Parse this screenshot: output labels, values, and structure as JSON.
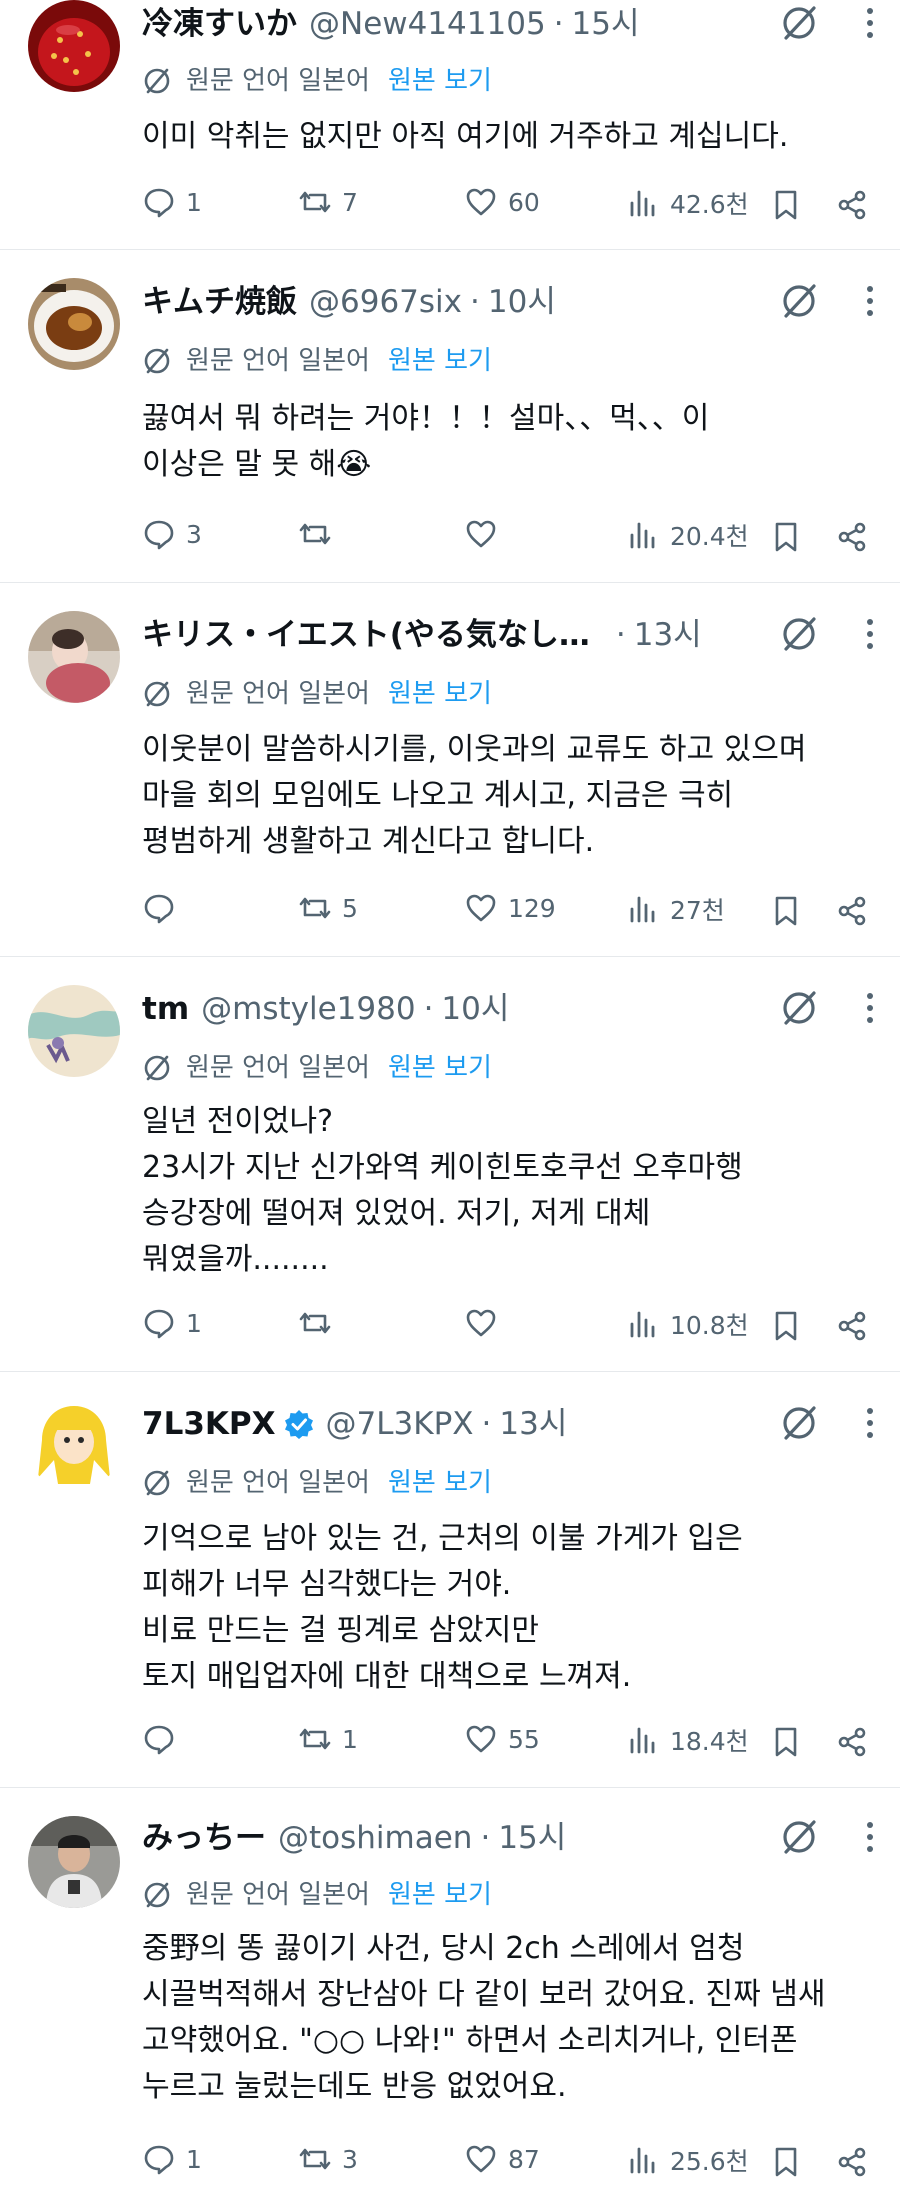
{
  "colors": {
    "accent": "#1d9bf0",
    "secondary_text": "#536471",
    "primary_text": "#0f1419",
    "divider": "#e6e9ec",
    "verified": "#1d9bf0"
  },
  "tweets": [
    {
      "name": "冷凍すいか",
      "handle": "@New4141105",
      "sep": "·",
      "time": "15시",
      "translation": {
        "lang": "원문 언어 일본어",
        "show_original": "원본 보기"
      },
      "lines": [
        "이미 악취는 없지만 아직 여기에 거주하고 계십니다."
      ],
      "replies": "1",
      "retweets": "7",
      "likes": "60",
      "views": "42.6천",
      "avatar_icon": "strawberry-avatar"
    },
    {
      "name": "キムチ焼飯",
      "handle": "@6967six",
      "sep": "·",
      "time": "10시",
      "translation": {
        "lang": "원문 언어 일본어",
        "show_original": "원본 보기"
      },
      "lines": [
        "끓여서 뭐 하려는 거야！！！설마、、먹、、이",
        "이상은 말 못 해😭"
      ],
      "replies": "3",
      "retweets": "",
      "likes": "",
      "views": "20.4천",
      "avatar_icon": "curry-plate-avatar"
    },
    {
      "name": "キリス・イエスト(やる気なし…",
      "handle": "",
      "sep": "·",
      "time": "13시",
      "translation": {
        "lang": "원문 언어 일본어",
        "show_original": "원본 보기"
      },
      "lines": [
        "이웃분이 말씀하시기를, 이웃과의 교류도 하고 있으며",
        "마을 회의 모임에도 나오고 계시고, 지금은 극히",
        "평범하게 생활하고 계신다고 합니다."
      ],
      "replies": "",
      "retweets": "5",
      "likes": "129",
      "views": "27천",
      "avatar_icon": "photo-avatar"
    },
    {
      "name": "tm",
      "handle": "@mstyle1980",
      "sep": "·",
      "time": "10시",
      "translation": {
        "lang": "원문 언어 일본어",
        "show_original": "원본 보기"
      },
      "lines": [
        "일년 전이었나?",
        "23시가 지난 신가와역 케이힌토호쿠선 오후마행",
        "승강장에 떨어져 있었어. 저기, 저게 대체",
        "뭐였을까........"
      ],
      "replies": "1",
      "retweets": "",
      "likes": "",
      "views": "10.8천",
      "avatar_icon": "illustration-avatar"
    },
    {
      "name": "7L3KPX",
      "handle": "@7L3KPX",
      "sep": "·",
      "time": "13시",
      "verified": true,
      "translation": {
        "lang": "원문 언어 일본어",
        "show_original": "원본 보기"
      },
      "lines": [
        "기억으로 남아 있는 건, 근처의 이불 가게가 입은",
        "피해가 너무 심각했다는 거야.",
        "비료 만드는 걸 핑계로 삼았지만",
        "토지 매입업자에 대한 대책으로 느껴져."
      ],
      "replies": "",
      "retweets": "1",
      "likes": "55",
      "views": "18.4천",
      "avatar_icon": "blonde-character-avatar"
    },
    {
      "name": "みっちー",
      "handle": "@toshimaen",
      "sep": "·",
      "time": "15시",
      "translation": {
        "lang": "원문 언어 일본어",
        "show_original": "원본 보기"
      },
      "lines": [
        "중野의 똥 끓이기 사건, 당시 2ch 스레에서 엄청",
        "시끌벅적해서 장난삼아 다 같이 보러 갔어요. 진짜 냄새",
        "고약했어요. \"○○ 나와!\" 하면서 소리치거나, 인터폰",
        "누르고 눌렀는데도 반응 없었어요."
      ],
      "replies": "1",
      "retweets": "3",
      "likes": "87",
      "views": "25.6천",
      "avatar_icon": "person-photo-avatar"
    }
  ]
}
